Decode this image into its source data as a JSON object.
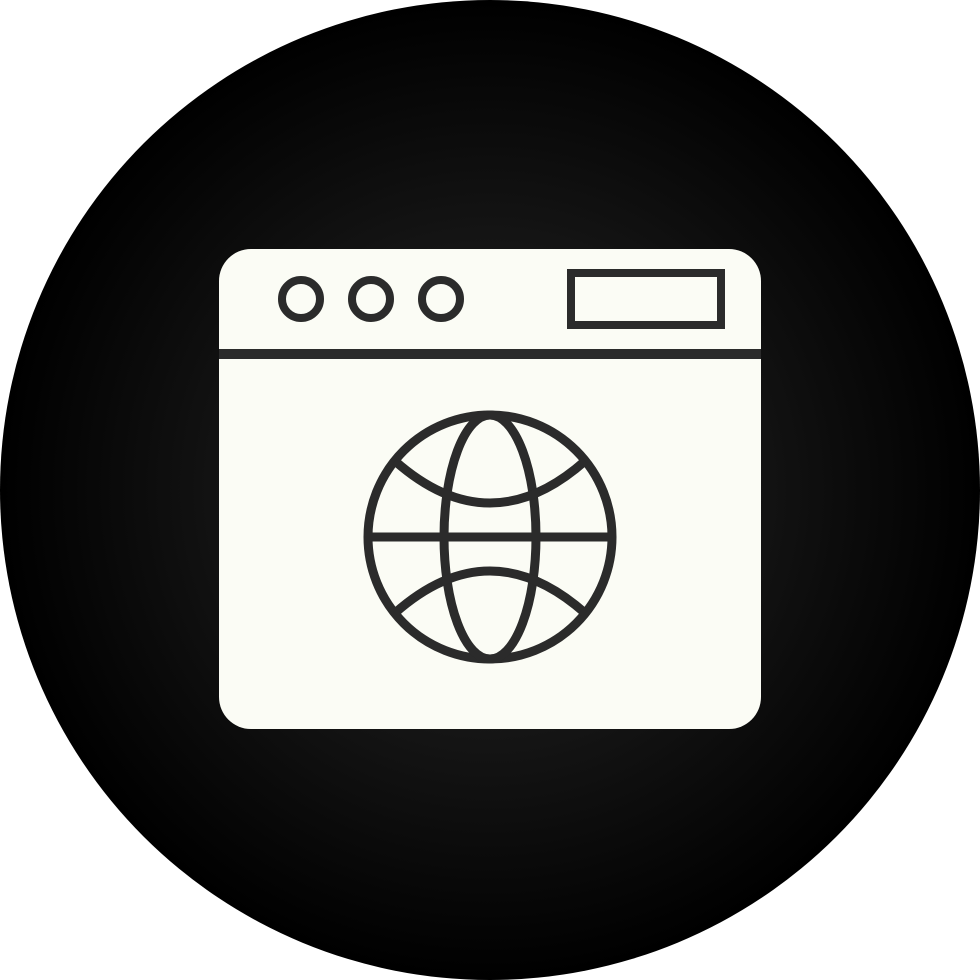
{
  "icon": {
    "name": "web-browser-globe-icon",
    "colors": {
      "page_background": "#ffffff",
      "circle_center": "#2a2a2a",
      "circle_edge": "#000000",
      "window_fill": "#fbfcf5",
      "line_stroke": "#2b2b2b"
    }
  }
}
